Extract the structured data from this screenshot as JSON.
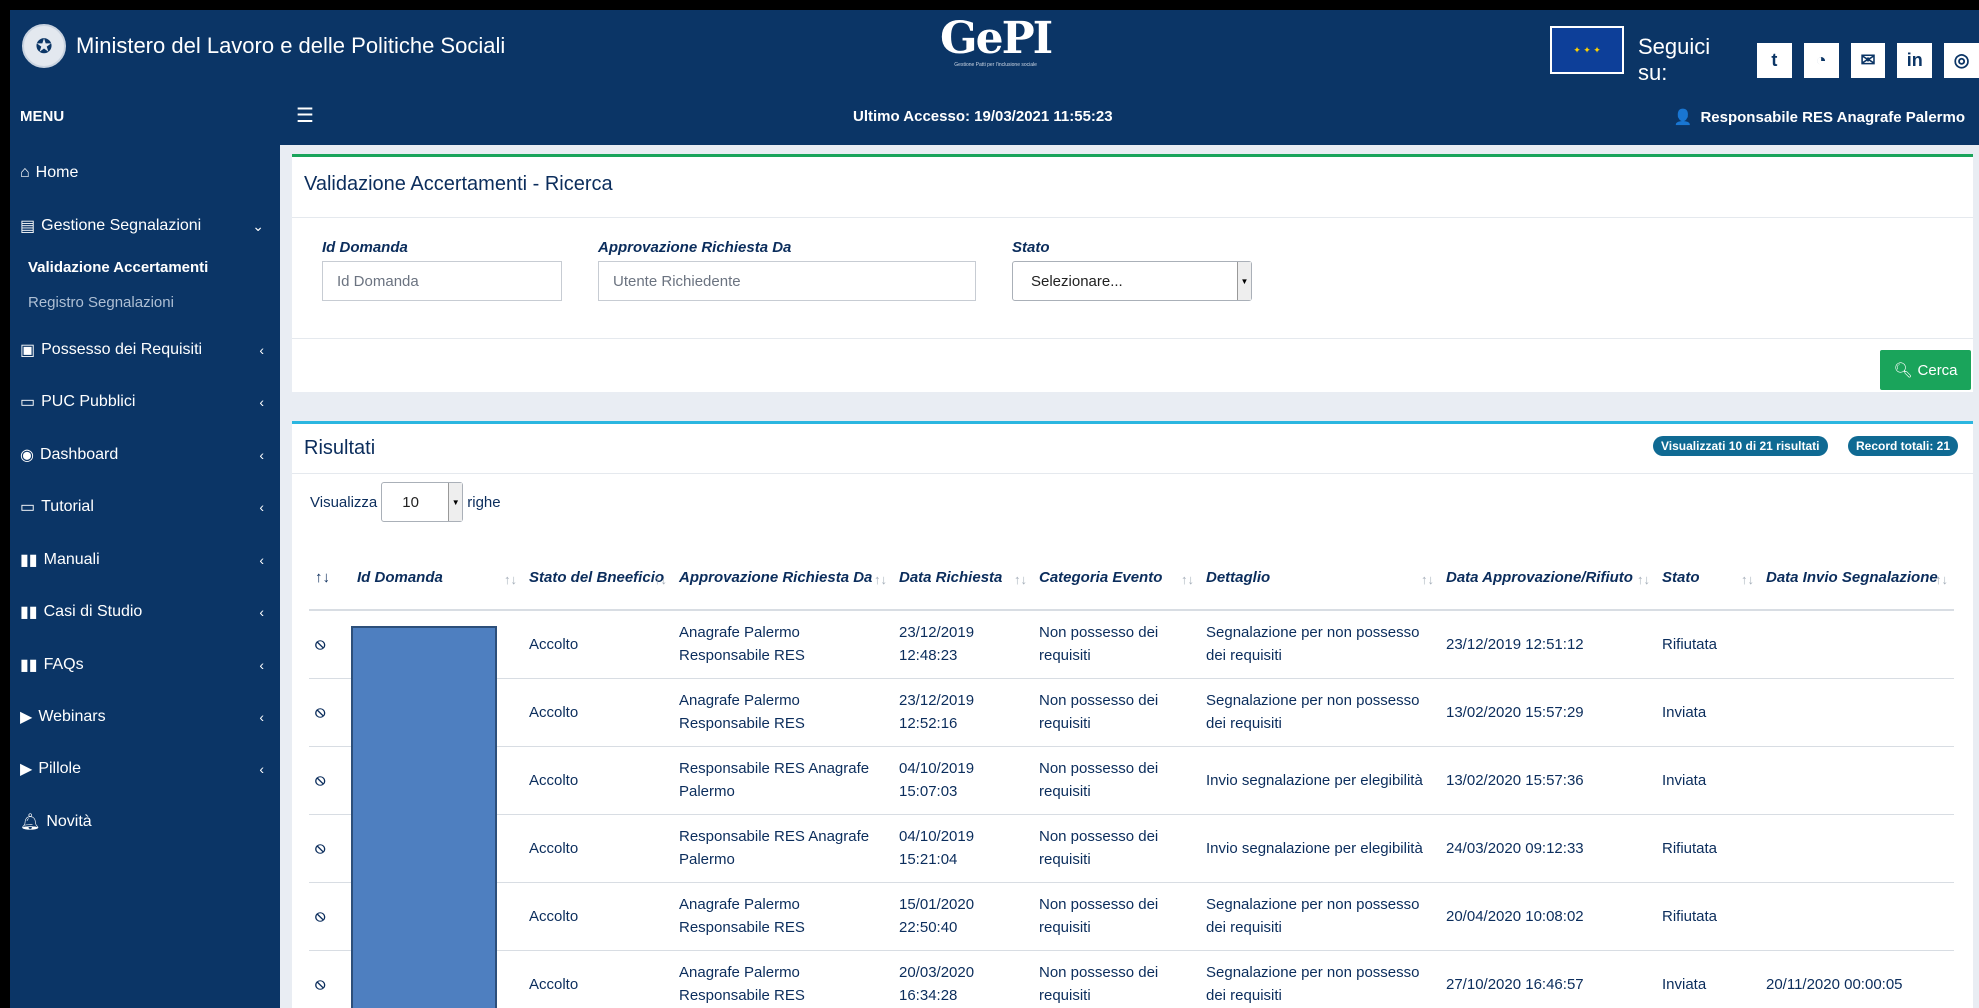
{
  "header": {
    "ministry": "Ministero del Lavoro e delle Politiche Sociali",
    "logo": "GePI",
    "logo_sub": "Gestione Patti per l'inclusione sociale",
    "follow": "Seguici su:",
    "social": [
      "twitter-icon",
      "rss-icon",
      "mail-icon",
      "linkedin-icon",
      "instagram-icon"
    ]
  },
  "subbar": {
    "menu": "MENU",
    "last_access": "Ultimo Accesso: 19/03/2021 11:55:23",
    "user": "Responsabile RES Anagrafe Palermo"
  },
  "sidebar": {
    "items": [
      {
        "label": "Home",
        "icon": "home-icon"
      },
      {
        "label": "Gestione Segnalazioni",
        "icon": "signal-icon",
        "chev": "⌄"
      },
      {
        "label": "Possesso dei Requisiti",
        "icon": "clipboard-icon",
        "chev": "‹"
      },
      {
        "label": "PUC Pubblici",
        "icon": "laptop-icon",
        "chev": "‹"
      },
      {
        "label": "Dashboard",
        "icon": "dashboard-icon",
        "chev": "‹"
      },
      {
        "label": "Tutorial",
        "icon": "tutorial-icon",
        "chev": "‹"
      },
      {
        "label": "Manuali",
        "icon": "book-icon",
        "chev": "‹"
      },
      {
        "label": "Casi di Studio",
        "icon": "book-icon",
        "chev": "‹"
      },
      {
        "label": "FAQs",
        "icon": "book-icon",
        "chev": "‹"
      },
      {
        "label": "Webinars",
        "icon": "video-icon",
        "chev": "‹"
      },
      {
        "label": "Pillole",
        "icon": "video-icon",
        "chev": "‹"
      },
      {
        "label": "Novità",
        "icon": "bell-icon"
      }
    ],
    "sub_active": "Validazione Accertamenti",
    "sub_other": "Registro Segnalazioni"
  },
  "search": {
    "title": "Validazione Accertamenti - Ricerca",
    "id_label": "Id Domanda",
    "id_placeholder": "Id Domanda",
    "appr_label": "Approvazione Richiesta Da",
    "appr_placeholder": "Utente Richiedente",
    "stato_label": "Stato",
    "stato_value": "Selezionare...",
    "button": "Cerca"
  },
  "results": {
    "title": "Risultati",
    "badge_visible": "Visualizzati 10 di 21 risultati",
    "badge_total": "Record totali: 21",
    "show_label": "Visualizza",
    "rows_value": "10",
    "rows_label": "righe",
    "columns": [
      "Id Domanda",
      "Stato del Bneeficio",
      "Approvazione Richiesta Da",
      "Data Richiesta",
      "Categoria Evento",
      "Dettaglio",
      "Data Approvazione/Rifiuto",
      "Stato",
      "Data Invio Segnalazione"
    ],
    "rows": [
      {
        "stato_beneficio": "Accolto",
        "approvazione": "Anagrafe Palermo Responsabile RES",
        "data_richiesta": "23/12/2019 12:48:23",
        "categoria": "Non possesso dei requisiti",
        "dettaglio": "Segnalazione per non possesso dei requisiti",
        "data_appr": "23/12/2019 12:51:12",
        "stato": "Rifiutata",
        "data_invio": ""
      },
      {
        "stato_beneficio": "Accolto",
        "approvazione": "Anagrafe Palermo Responsabile RES",
        "data_richiesta": "23/12/2019 12:52:16",
        "categoria": "Non possesso dei requisiti",
        "dettaglio": "Segnalazione per non possesso dei requisiti",
        "data_appr": "13/02/2020 15:57:29",
        "stato": "Inviata",
        "data_invio": ""
      },
      {
        "stato_beneficio": "Accolto",
        "approvazione": "Responsabile RES Anagrafe Palermo",
        "data_richiesta": "04/10/2019 15:07:03",
        "categoria": "Non possesso dei requisiti",
        "dettaglio": "Invio segnalazione per elegibilità",
        "data_appr": "13/02/2020 15:57:36",
        "stato": "Inviata",
        "data_invio": ""
      },
      {
        "stato_beneficio": "Accolto",
        "approvazione": "Responsabile RES Anagrafe Palermo",
        "data_richiesta": "04/10/2019 15:21:04",
        "categoria": "Non possesso dei requisiti",
        "dettaglio": "Invio segnalazione per elegibilità",
        "data_appr": "24/03/2020 09:12:33",
        "stato": "Rifiutata",
        "data_invio": ""
      },
      {
        "stato_beneficio": "Accolto",
        "approvazione": "Anagrafe Palermo Responsabile RES",
        "data_richiesta": "15/01/2020 22:50:40",
        "categoria": "Non possesso dei requisiti",
        "dettaglio": "Segnalazione per non possesso dei requisiti",
        "data_appr": "20/04/2020 10:08:02",
        "stato": "Rifiutata",
        "data_invio": ""
      },
      {
        "stato_beneficio": "Accolto",
        "approvazione": "Anagrafe Palermo Responsabile RES",
        "data_richiesta": "20/03/2020 16:34:28",
        "categoria": "Non possesso dei requisiti",
        "dettaglio": "Segnalazione per non possesso dei requisiti",
        "data_appr": "27/10/2020 16:46:57",
        "stato": "Inviata",
        "data_invio": "20/11/2020 00:00:05"
      }
    ]
  }
}
